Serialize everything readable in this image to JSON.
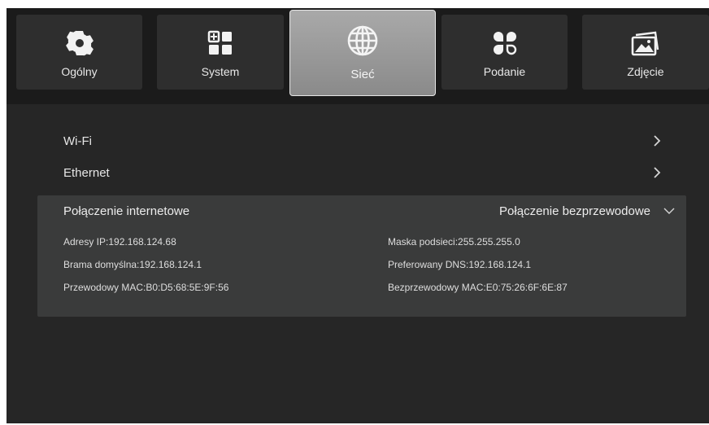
{
  "tabs": [
    {
      "label": "Ogólny",
      "icon": "gear-icon",
      "active": false
    },
    {
      "label": "System",
      "icon": "grid-icon",
      "active": false
    },
    {
      "label": "Sieć",
      "icon": "globe-icon",
      "active": true
    },
    {
      "label": "Podanie",
      "icon": "apps-icon",
      "active": false
    },
    {
      "label": "Zdjęcie",
      "icon": "picture-icon",
      "active": false
    }
  ],
  "menu": {
    "wifi": "Wi-Fi",
    "ethernet": "Ethernet"
  },
  "connection": {
    "label": "Połączenie internetowe",
    "value": "Połączenie bezprzewodowe",
    "ip": "Adresy IP:192.168.124.68",
    "mask": "Maska podsieci:255.255.255.0",
    "gateway": "Brama domyślna:192.168.124.1",
    "dns": "Preferowany DNS:192.168.124.1",
    "wired_mac": "Przewodowy MAC:B0:D5:68:5E:9F:56",
    "wireless_mac": "Bezprzewodowy MAC:E0:75:26:6F:6E:87"
  },
  "colors": {
    "background": "#262626",
    "tab": "#2e2e2e",
    "tab_active": "#9a9a9a",
    "panel": "#3a3b3b",
    "text": "#e6e6e6"
  }
}
